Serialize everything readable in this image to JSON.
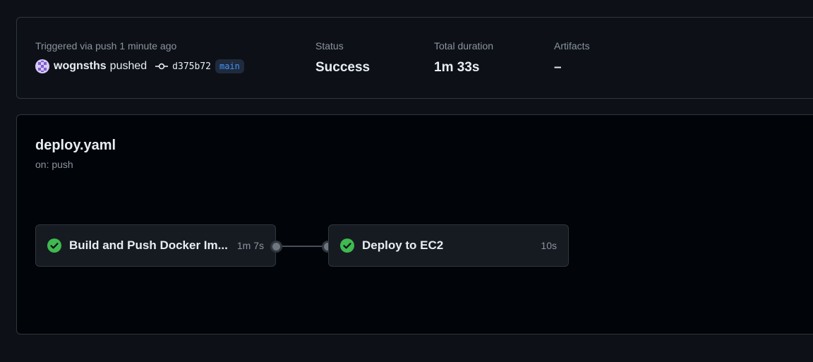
{
  "summary": {
    "trigger_label": "Triggered via push 1 minute ago",
    "actor": "wognsths",
    "action": "pushed",
    "commit_sha": "d375b72",
    "branch": "main",
    "status_label": "Status",
    "status_value": "Success",
    "duration_label": "Total duration",
    "duration_value": "1m 33s",
    "artifacts_label": "Artifacts",
    "artifacts_value": "–"
  },
  "workflow": {
    "file": "deploy.yaml",
    "trigger": "on: push",
    "jobs": [
      {
        "name": "Build and Push Docker Im...",
        "duration": "1m 7s",
        "status": "success"
      },
      {
        "name": "Deploy to EC2",
        "duration": "10s",
        "status": "success"
      }
    ]
  },
  "colors": {
    "success": "#3fb950",
    "branch_text": "#4493f8",
    "branch_bg": "#1f2a3c",
    "muted_text": "#8b949e",
    "border": "#30363d"
  },
  "icons": {
    "avatar": "identicon-avatar",
    "commit": "git-commit-icon",
    "job_status": "check-circle-fill-icon"
  }
}
